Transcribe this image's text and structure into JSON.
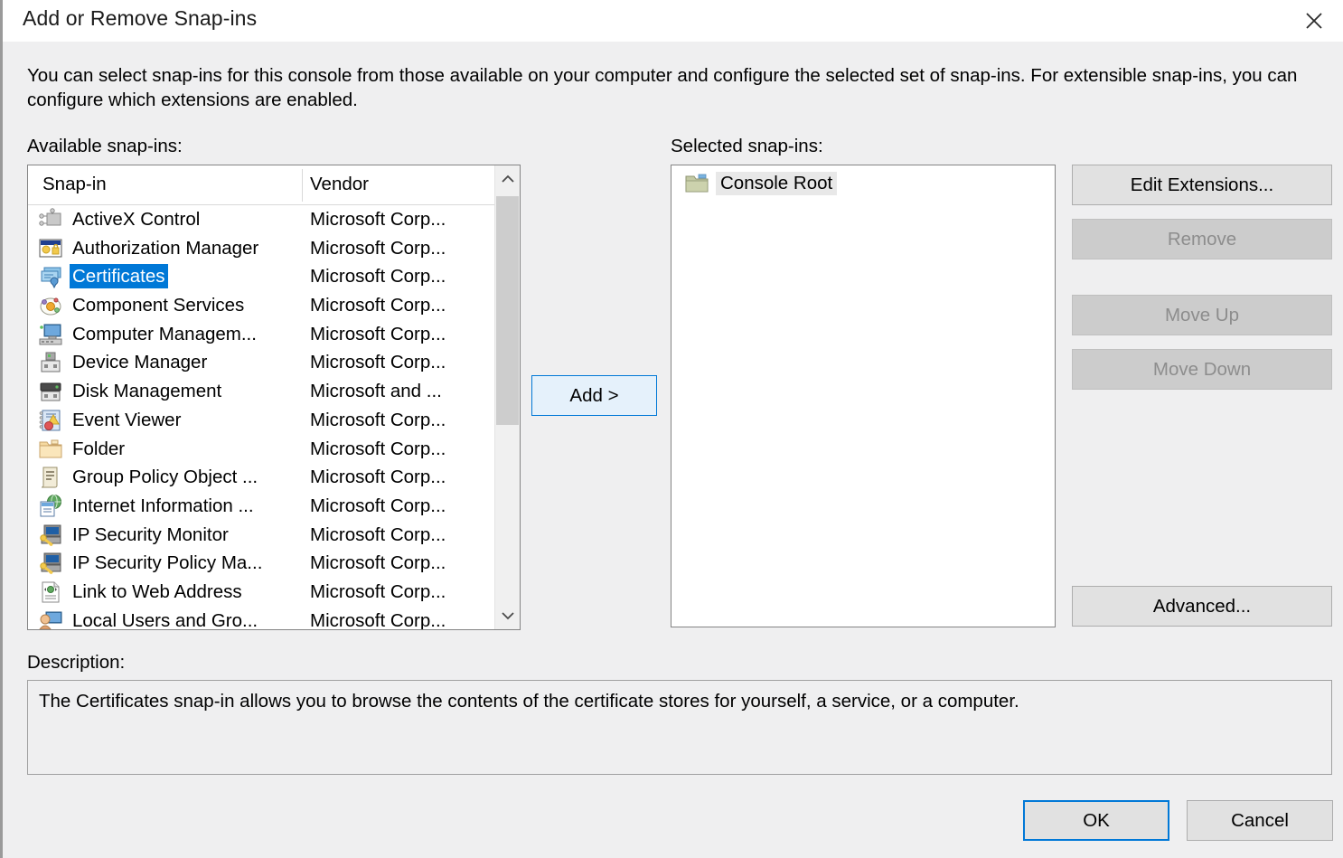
{
  "window": {
    "title": "Add or Remove Snap-ins",
    "close_icon": "close-icon"
  },
  "intro": "You can select snap-ins for this console from those available on your computer and configure the selected set of snap-ins. For extensible snap-ins, you can configure which extensions are enabled.",
  "available": {
    "label": "Available snap-ins:",
    "columns": [
      "Snap-in",
      "Vendor"
    ],
    "rows": [
      {
        "name": "ActiveX Control",
        "vendor": "Microsoft Corp...",
        "icon": "activex-control-icon",
        "selected": false
      },
      {
        "name": "Authorization Manager",
        "vendor": "Microsoft Corp...",
        "icon": "authorization-manager-icon",
        "selected": false
      },
      {
        "name": "Certificates",
        "vendor": "Microsoft Corp...",
        "icon": "certificates-icon",
        "selected": true
      },
      {
        "name": "Component Services",
        "vendor": "Microsoft Corp...",
        "icon": "component-services-icon",
        "selected": false
      },
      {
        "name": "Computer Managem...",
        "vendor": "Microsoft Corp...",
        "icon": "computer-management-icon",
        "selected": false
      },
      {
        "name": "Device Manager",
        "vendor": "Microsoft Corp...",
        "icon": "device-manager-icon",
        "selected": false
      },
      {
        "name": "Disk Management",
        "vendor": "Microsoft and ...",
        "icon": "disk-management-icon",
        "selected": false
      },
      {
        "name": "Event Viewer",
        "vendor": "Microsoft Corp...",
        "icon": "event-viewer-icon",
        "selected": false
      },
      {
        "name": "Folder",
        "vendor": "Microsoft Corp...",
        "icon": "folder-icon",
        "selected": false
      },
      {
        "name": "Group Policy Object ...",
        "vendor": "Microsoft Corp...",
        "icon": "group-policy-icon",
        "selected": false
      },
      {
        "name": "Internet Information ...",
        "vendor": "Microsoft Corp...",
        "icon": "internet-information-icon",
        "selected": false
      },
      {
        "name": "IP Security Monitor",
        "vendor": "Microsoft Corp...",
        "icon": "ip-security-monitor-icon",
        "selected": false
      },
      {
        "name": "IP Security Policy Ma...",
        "vendor": "Microsoft Corp...",
        "icon": "ip-security-policy-icon",
        "selected": false
      },
      {
        "name": "Link to Web Address",
        "vendor": "Microsoft Corp...",
        "icon": "link-to-web-address-icon",
        "selected": false
      },
      {
        "name": "Local Users and Gro...",
        "vendor": "Microsoft Corp...",
        "icon": "local-users-icon",
        "selected": false
      }
    ],
    "scroll": {
      "up_icon": "chevron-up-icon",
      "down_icon": "chevron-down-icon"
    }
  },
  "add_button": {
    "label": "Add >"
  },
  "selected_panel": {
    "label": "Selected snap-ins:",
    "items": [
      {
        "name": "Console Root",
        "icon": "folder-icon"
      }
    ]
  },
  "side_buttons": [
    {
      "label": "Edit Extensions...",
      "enabled": true
    },
    {
      "label": "Remove",
      "enabled": false
    },
    {
      "label": "Move Up",
      "enabled": false
    },
    {
      "label": "Move Down",
      "enabled": false
    },
    {
      "label": "Advanced...",
      "enabled": true
    }
  ],
  "description": {
    "label": "Description:",
    "text": "The Certificates snap-in allows you to browse the contents of the certificate stores for yourself, a service, or a computer."
  },
  "footer": {
    "ok": "OK",
    "cancel": "Cancel"
  },
  "colors": {
    "accent": "#0078d7",
    "selection_bg": "#0078d7",
    "dialog_bg": "#efeff0",
    "button_bg": "#e1e1e1",
    "disabled_bg": "#cccccc",
    "disabled_text": "#8d8d8d"
  }
}
